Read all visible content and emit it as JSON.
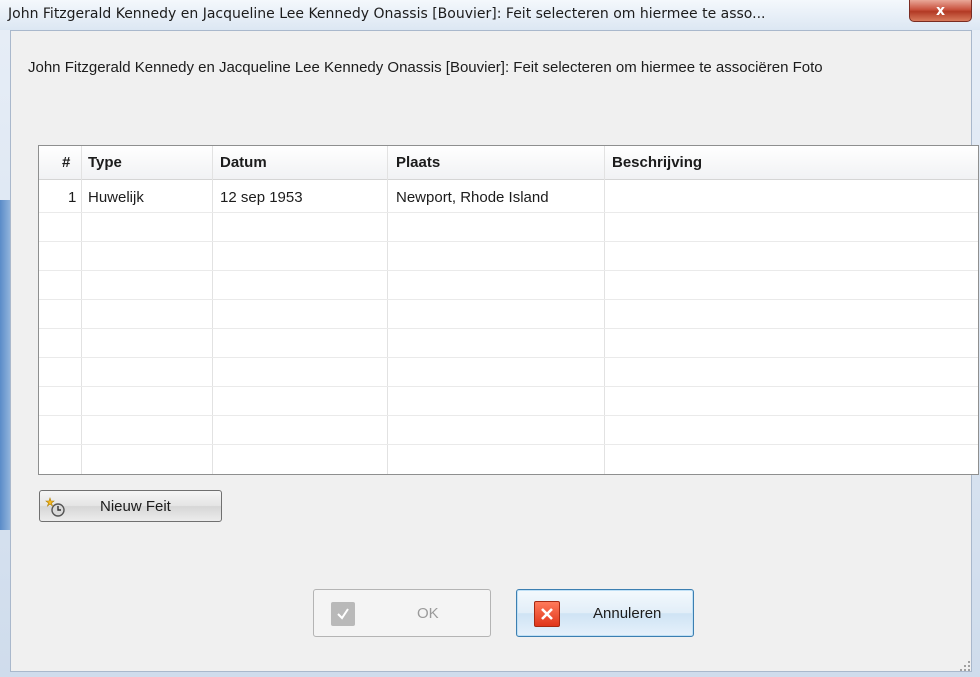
{
  "window": {
    "title": "John Fitzgerald Kennedy en Jacqueline Lee Kennedy Onassis [Bouvier]: Feit selecteren om hiermee te asso...",
    "close_label": "x"
  },
  "prompt": "John Fitzgerald Kennedy en Jacqueline Lee Kennedy Onassis [Bouvier]: Feit selecteren om hiermee te associëren Foto",
  "table": {
    "columns": [
      "#",
      "Type",
      "Datum",
      "Plaats",
      "Beschrijving"
    ],
    "rows": [
      {
        "num": "1",
        "type": "Huwelijk",
        "datum": "12 sep 1953",
        "plaats": "Newport, Rhode Island",
        "beschrijving": ""
      }
    ]
  },
  "buttons": {
    "new_fact": "Nieuw Feit",
    "ok": "OK",
    "cancel": "Annuleren"
  },
  "colors": {
    "accent": "#3c7fb1",
    "cancel_red": "#e0361b"
  }
}
